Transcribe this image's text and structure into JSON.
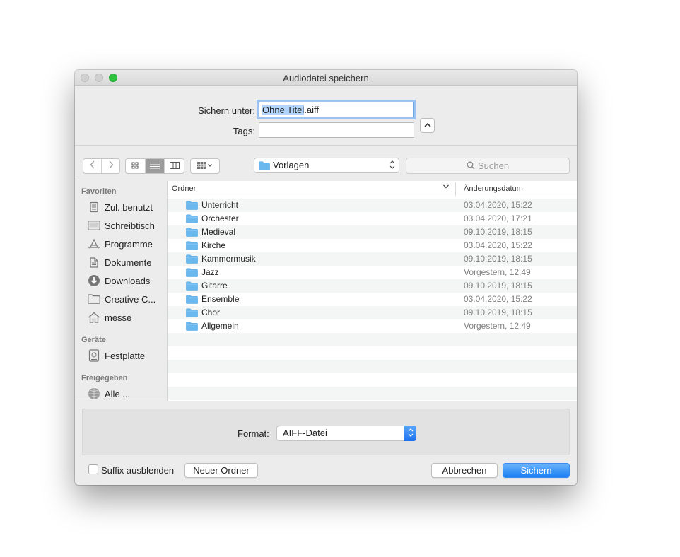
{
  "window": {
    "title": "Audiodatei speichern"
  },
  "save": {
    "save_as_label": "Sichern unter:",
    "filename_selected": "Ohne Titel",
    "filename_rest": ".aiff",
    "tags_label": "Tags:",
    "tags_value": ""
  },
  "toolbar": {
    "location": "Vorlagen",
    "search_placeholder": "Suchen"
  },
  "sidebar": {
    "favorites_header": "Favoriten",
    "favorites": [
      {
        "label": "Zul. benutzt",
        "icon": "recents-icon"
      },
      {
        "label": "Schreibtisch",
        "icon": "desktop-icon"
      },
      {
        "label": "Programme",
        "icon": "applications-icon"
      },
      {
        "label": "Dokumente",
        "icon": "documents-icon"
      },
      {
        "label": "Downloads",
        "icon": "downloads-icon"
      },
      {
        "label": "Creative C...",
        "icon": "folder-icon"
      },
      {
        "label": "messe",
        "icon": "home-icon"
      }
    ],
    "devices_header": "Geräte",
    "devices": [
      {
        "label": "Festplatte",
        "icon": "harddisk-icon"
      }
    ],
    "shared_header": "Freigegeben",
    "shared": [
      {
        "label": "Alle ...",
        "icon": "network-icon"
      }
    ]
  },
  "files": {
    "col_name": "Ordner",
    "col_date": "Änderungsdatum",
    "rows": [
      {
        "name": "Unterricht",
        "date": "03.04.2020, 15:22"
      },
      {
        "name": "Orchester",
        "date": "03.04.2020, 17:21"
      },
      {
        "name": "Medieval",
        "date": "09.10.2019, 18:15"
      },
      {
        "name": "Kirche",
        "date": "03.04.2020, 15:22"
      },
      {
        "name": "Kammermusik",
        "date": "09.10.2019, 18:15"
      },
      {
        "name": "Jazz",
        "date": "Vorgestern, 12:49"
      },
      {
        "name": "Gitarre",
        "date": "09.10.2019, 18:15"
      },
      {
        "name": "Ensemble",
        "date": "03.04.2020, 15:22"
      },
      {
        "name": "Chor",
        "date": "09.10.2019, 18:15"
      },
      {
        "name": "Allgemein",
        "date": "Vorgestern, 12:49"
      }
    ]
  },
  "format": {
    "label": "Format:",
    "value": "AIFF-Datei"
  },
  "buttons": {
    "hide_suffix": "Suffix ausblenden",
    "new_folder": "Neuer Ordner",
    "cancel": "Abbrechen",
    "save": "Sichern"
  },
  "colors": {
    "accent": "#1a7ef4",
    "folder": "#6bb8ef",
    "zoom": "#2dc43f"
  }
}
